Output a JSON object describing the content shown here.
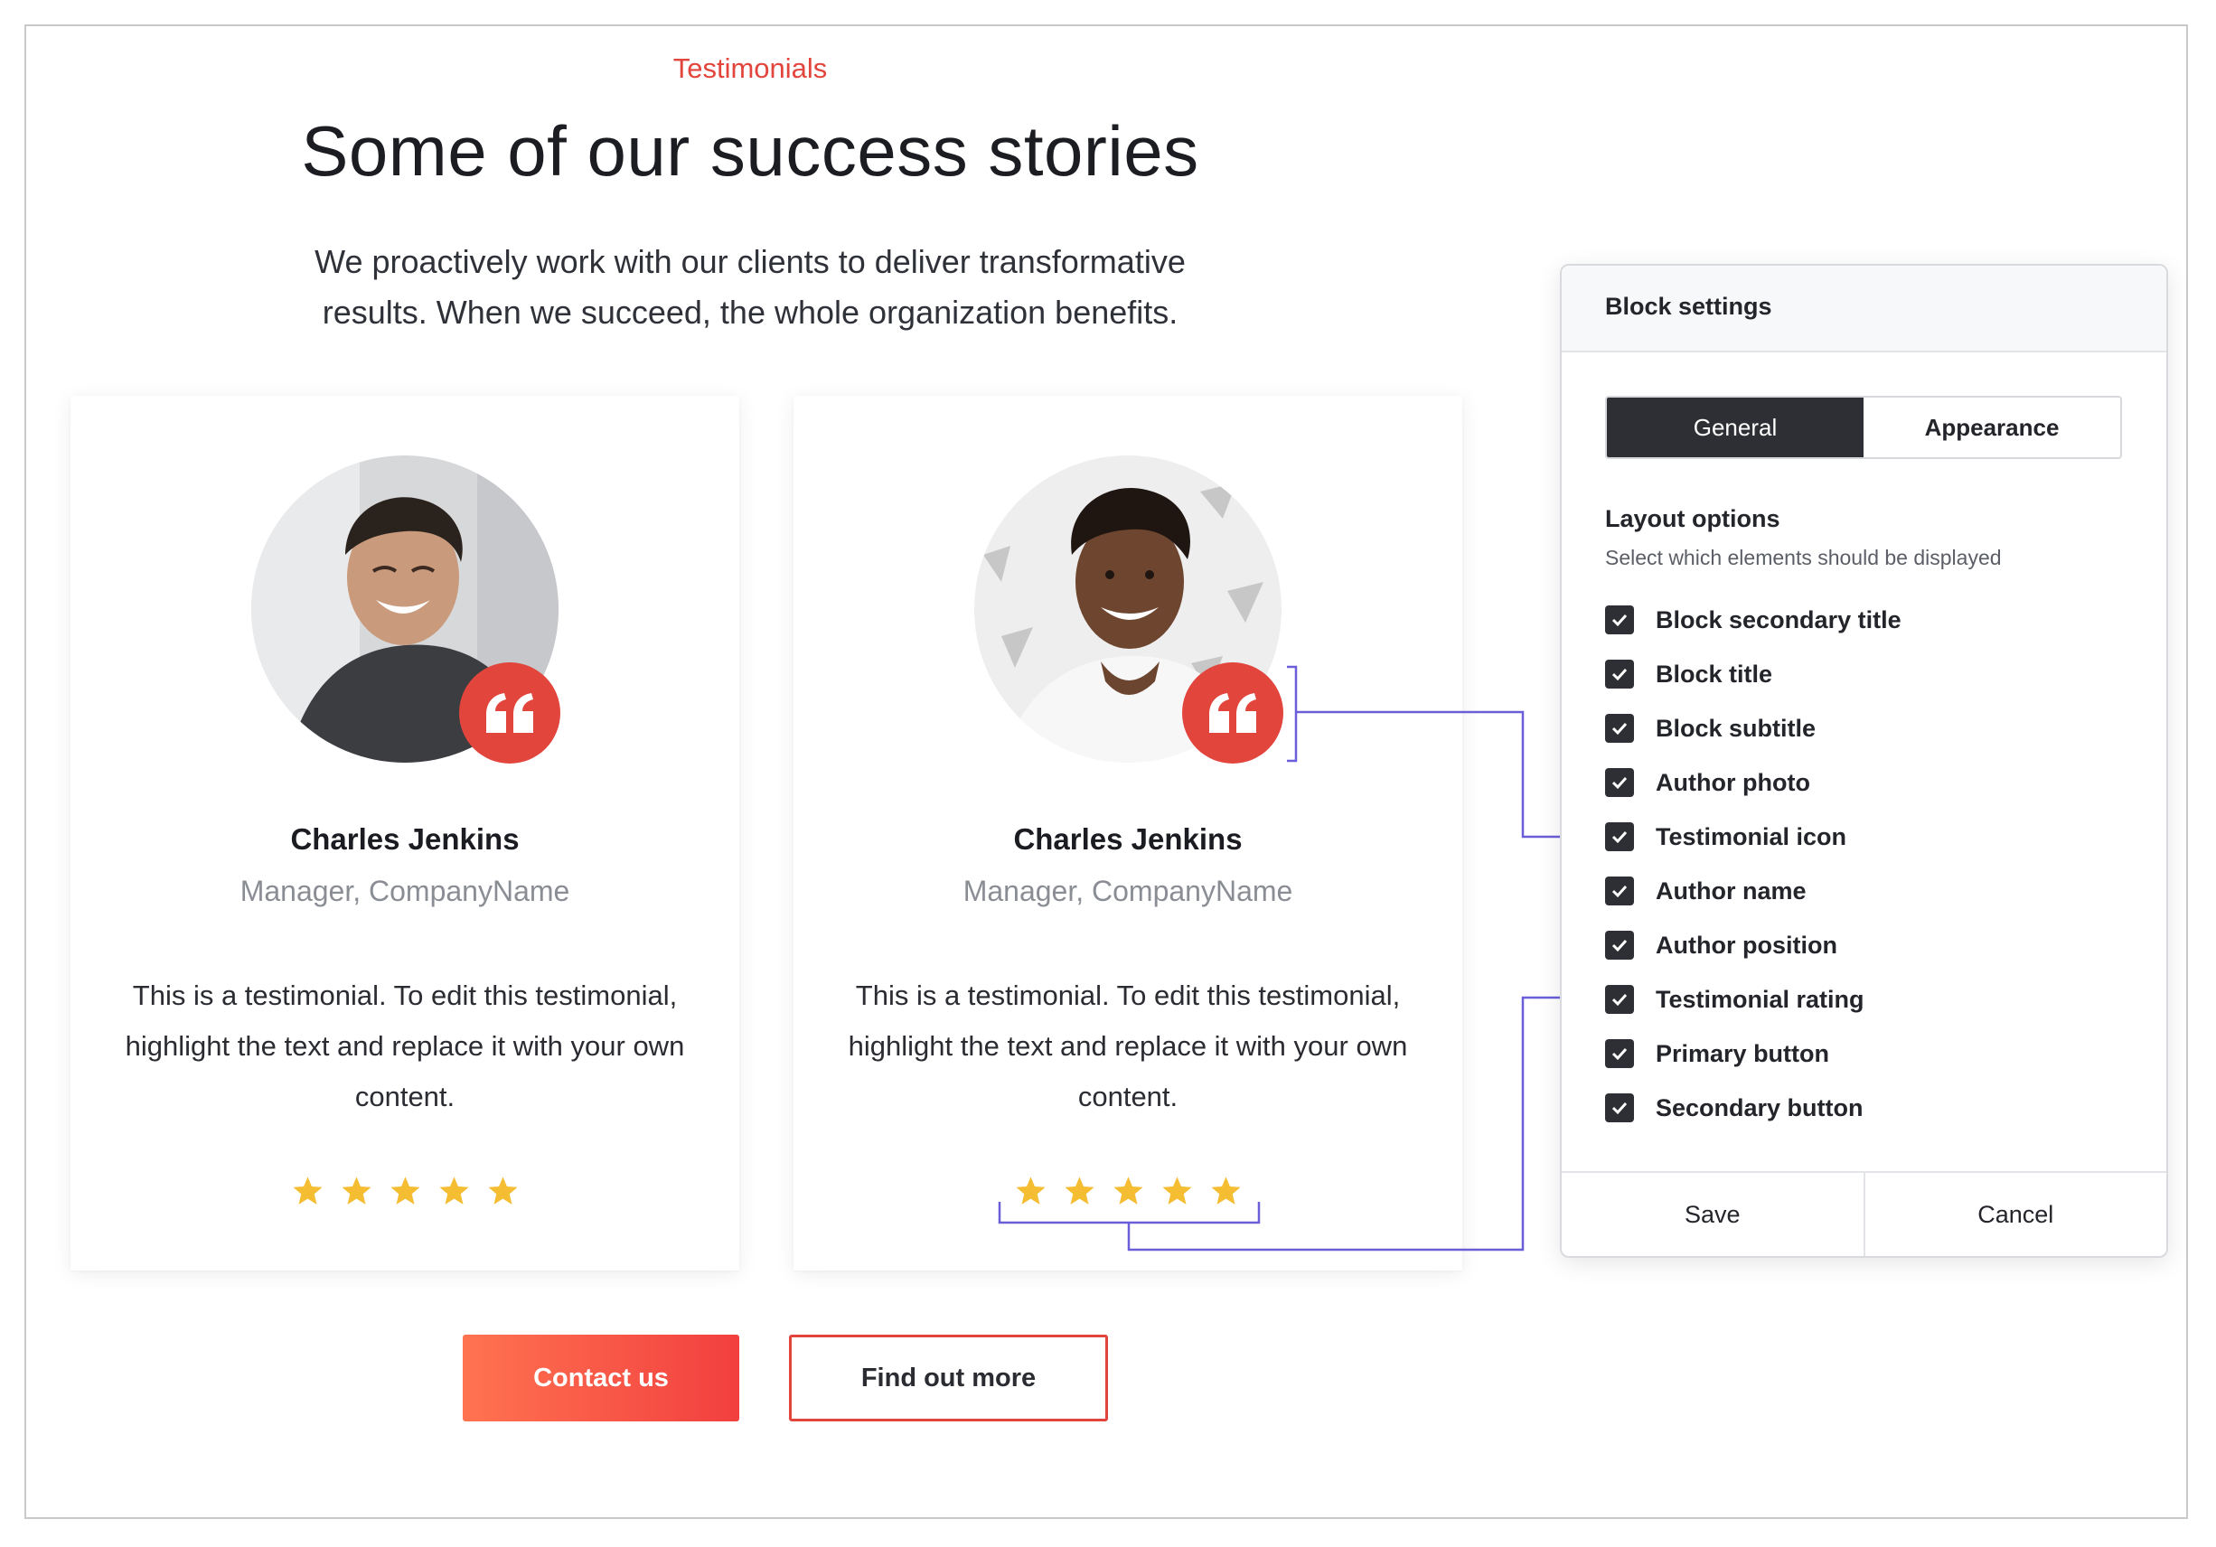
{
  "page": {
    "secondary_title": "Testimonials",
    "title": "Some of our success stories",
    "subtitle": "We proactively work with our clients to deliver transformative results. When we succeed, the whole organization benefits."
  },
  "testimonials": [
    {
      "name": "Charles Jenkins",
      "position": "Manager, CompanyName",
      "text": "This is a testimonial. To edit this testimonial, highlight the text and replace it with your own content.",
      "rating": 5
    },
    {
      "name": "Charles Jenkins",
      "position": "Manager, CompanyName",
      "text": "This is a testimonial. To edit this testimonial, highlight the text and replace it with your own content.",
      "rating": 5
    }
  ],
  "buttons": {
    "primary": "Contact us",
    "secondary": "Find out more"
  },
  "panel": {
    "title": "Block settings",
    "tabs": [
      "General",
      "Appearance"
    ],
    "active_tab": "General",
    "layout_title": "Layout options",
    "layout_desc": "Select which elements should be displayed",
    "options": [
      {
        "label": "Block secondary title",
        "checked": true
      },
      {
        "label": "Block title",
        "checked": true
      },
      {
        "label": "Block subtitle",
        "checked": true
      },
      {
        "label": "Author photo",
        "checked": true
      },
      {
        "label": "Testimonial icon",
        "checked": true
      },
      {
        "label": "Author name",
        "checked": true
      },
      {
        "label": "Author position",
        "checked": true
      },
      {
        "label": "Testimonial rating",
        "checked": true
      },
      {
        "label": "Primary button",
        "checked": true
      },
      {
        "label": "Secondary button",
        "checked": true
      }
    ],
    "save": "Save",
    "cancel": "Cancel"
  },
  "colors": {
    "accent": "#e2453c",
    "star": "#f5bd32",
    "connector": "#6a5fd8",
    "dark": "#2e2f34"
  }
}
